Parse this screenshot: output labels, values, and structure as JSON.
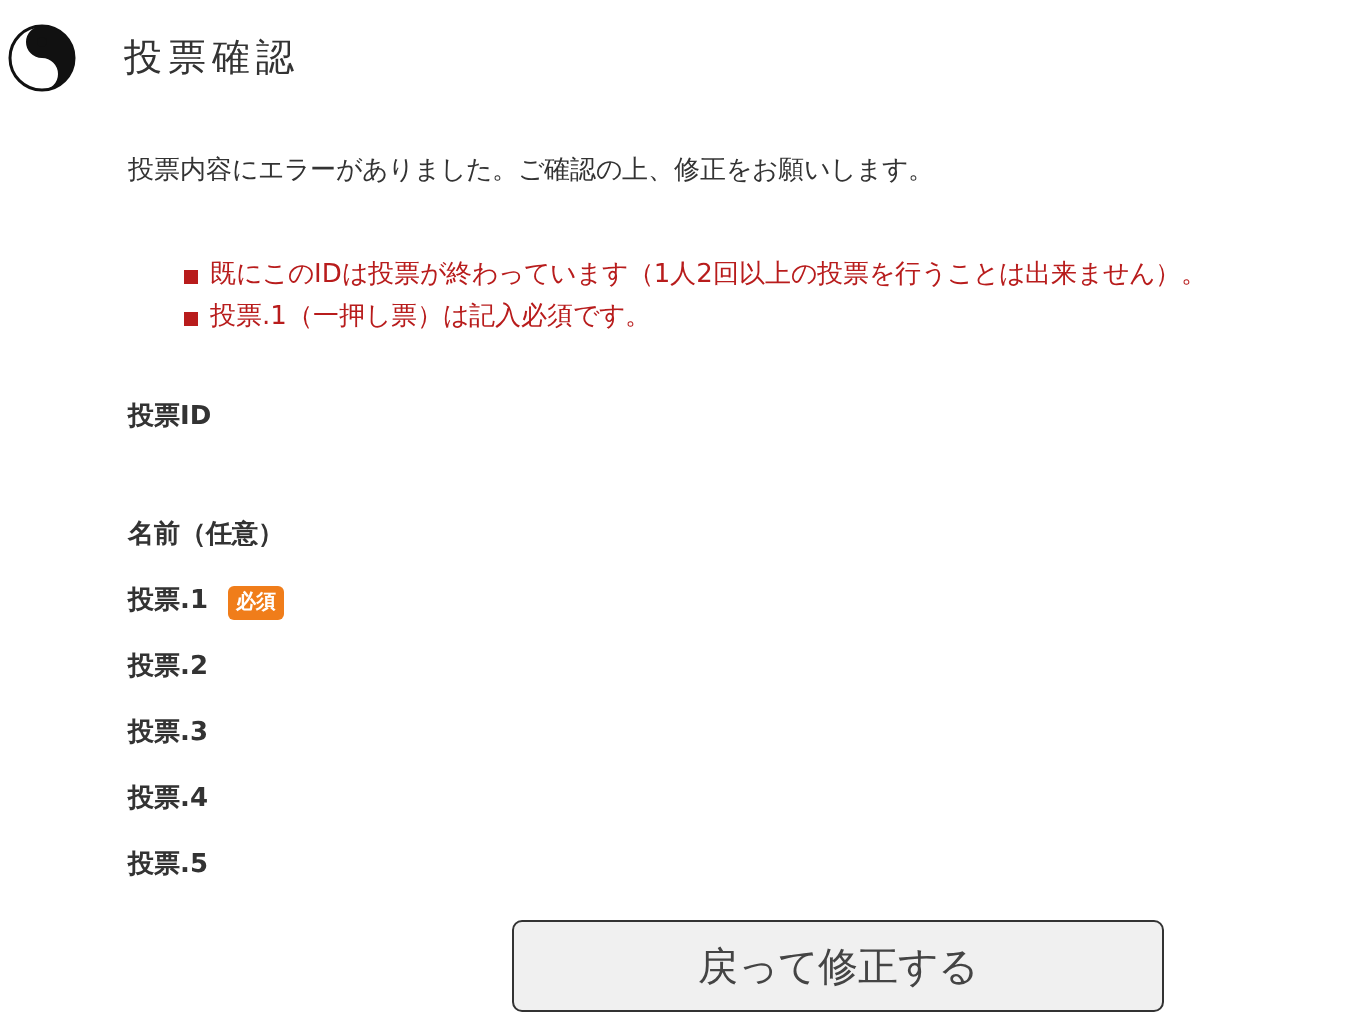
{
  "title": "投票確認",
  "message": "投票内容にエラーがありました。ご確認の上、修正をお願いします。",
  "errors": [
    "既にこのIDは投票が終わっています（1人2回以上の投票を行うことは出来ません）。",
    "投票.1（一押し票）は記入必須です。"
  ],
  "fields": [
    {
      "label": "投票ID"
    },
    {
      "label": "名前（任意）"
    },
    {
      "label": "投票.1",
      "badge": "必須"
    },
    {
      "label": "投票.2"
    },
    {
      "label": "投票.3"
    },
    {
      "label": "投票.4"
    },
    {
      "label": "投票.5"
    }
  ],
  "buttons": [
    "戻って修正する"
  ]
}
